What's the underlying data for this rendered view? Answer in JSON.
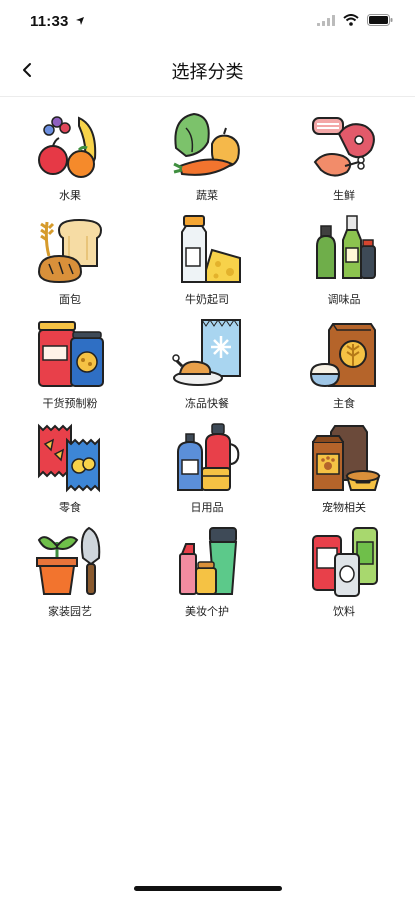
{
  "status": {
    "time": "11:33",
    "location_icon": "location-arrow-icon",
    "signal_icon": "signal-icon",
    "wifi_icon": "wifi-icon",
    "battery_icon": "battery-icon"
  },
  "nav": {
    "title": "选择分类",
    "back_icon": "chevron-left-icon"
  },
  "categories": [
    {
      "label": "水果",
      "icon": "fruit-icon"
    },
    {
      "label": "蔬菜",
      "icon": "vegetable-icon"
    },
    {
      "label": "生鲜",
      "icon": "fresh-meat-icon"
    },
    {
      "label": "面包",
      "icon": "bread-icon"
    },
    {
      "label": "牛奶起司",
      "icon": "milk-cheese-icon"
    },
    {
      "label": "调味品",
      "icon": "condiment-icon"
    },
    {
      "label": "干货预制粉",
      "icon": "dry-goods-icon"
    },
    {
      "label": "冻品快餐",
      "icon": "frozen-food-icon"
    },
    {
      "label": "主食",
      "icon": "staple-food-icon"
    },
    {
      "label": "零食",
      "icon": "snack-icon"
    },
    {
      "label": "日用品",
      "icon": "daily-goods-icon"
    },
    {
      "label": "宠物相关",
      "icon": "pet-supplies-icon"
    },
    {
      "label": "家装园艺",
      "icon": "home-garden-icon"
    },
    {
      "label": "美妆个护",
      "icon": "beauty-care-icon"
    },
    {
      "label": "饮料",
      "icon": "beverage-icon"
    }
  ]
}
